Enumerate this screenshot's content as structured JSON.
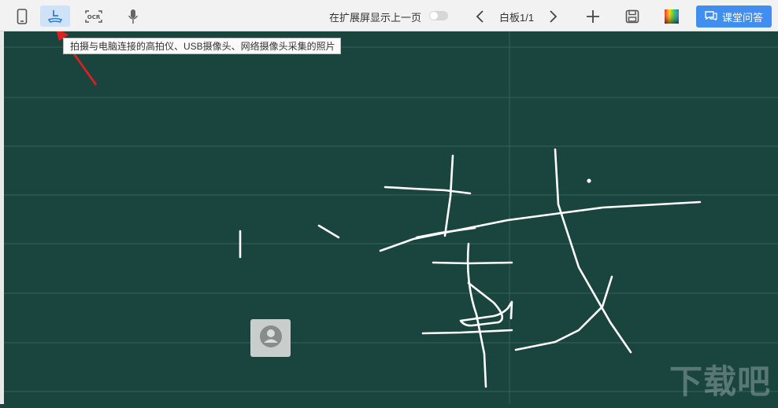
{
  "toolbar": {
    "tools": [
      {
        "name": "phone-icon"
      },
      {
        "name": "camera-capture-icon"
      },
      {
        "name": "ocr-icon",
        "label": "OCR"
      },
      {
        "name": "microphone-icon"
      }
    ],
    "extend_label": "在扩展屏显示上一页",
    "page_label": "白板1/1",
    "ask_button_label": "课堂问答"
  },
  "tooltip": "拍摄与电脑连接的高拍仪、USB摄像头、网络摄像头采集的照片",
  "watermark": "下载吧",
  "colors": {
    "board": "#1a453f",
    "grid": "#2f5e56",
    "ink": "#ffffff",
    "accent": "#3f8ef0",
    "arrow": "#e02020"
  }
}
